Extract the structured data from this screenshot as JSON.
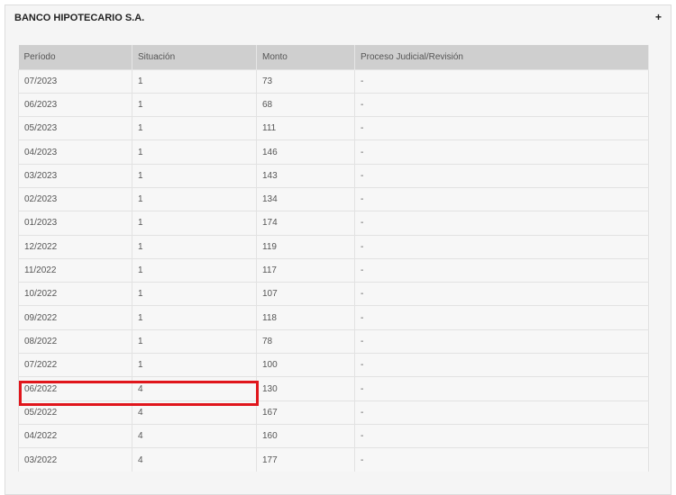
{
  "panel": {
    "title": "BANCO HIPOTECARIO S.A.",
    "toggle_label": "+"
  },
  "table": {
    "headers": [
      "Período",
      "Situación",
      "Monto",
      "Proceso Judicial/Revisión"
    ],
    "rows": [
      [
        "07/2023",
        "1",
        "73",
        "-"
      ],
      [
        "06/2023",
        "1",
        "68",
        "-"
      ],
      [
        "05/2023",
        "1",
        "111",
        "-"
      ],
      [
        "04/2023",
        "1",
        "146",
        "-"
      ],
      [
        "03/2023",
        "1",
        "143",
        "-"
      ],
      [
        "02/2023",
        "1",
        "134",
        "-"
      ],
      [
        "01/2023",
        "1",
        "174",
        "-"
      ],
      [
        "12/2022",
        "1",
        "119",
        "-"
      ],
      [
        "11/2022",
        "1",
        "117",
        "-"
      ],
      [
        "10/2022",
        "1",
        "107",
        "-"
      ],
      [
        "09/2022",
        "1",
        "118",
        "-"
      ],
      [
        "08/2022",
        "1",
        "78",
        "-"
      ],
      [
        "07/2022",
        "1",
        "100",
        "-"
      ],
      [
        "06/2022",
        "4",
        "130",
        "-"
      ],
      [
        "05/2022",
        "4",
        "167",
        "-"
      ],
      [
        "04/2022",
        "4",
        "160",
        "-"
      ],
      [
        "03/2022",
        "4",
        "177",
        "-"
      ]
    ]
  },
  "highlight": {
    "row_index": 13,
    "color": "#e0161c"
  }
}
